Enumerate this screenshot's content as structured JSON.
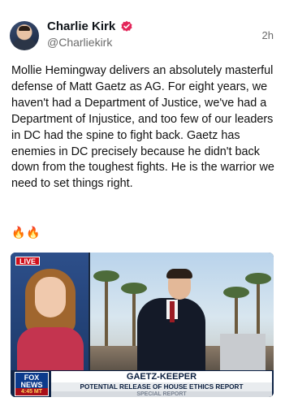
{
  "author": {
    "name": "Charlie Kirk",
    "handle": "@Charliekirk",
    "verified_icon": "verified-badge-icon",
    "avatar_icon": "profile-photo"
  },
  "post": {
    "time": "2h",
    "text": "Mollie Hemingway delivers an absolutely masterful defense of Matt Gaetz as AG. For eight years, we haven't had a Department of Justice, we've had a Department of Injustice, and too few of our leaders in DC had the spine to fight back. Gaetz has enemies in DC precisely because he didn't back down from the toughest fights. He is the warrior we need to set things right.",
    "emoji": "🔥🔥"
  },
  "media": {
    "live_label": "LIVE",
    "network_logo": "FOX NEWS",
    "network_time": "4:45 MT",
    "headline": "GAETZ-KEEPER",
    "subheadline": "POTENTIAL RELEASE OF HOUSE ETHICS REPORT",
    "ticker_ghost": "SPECIAL REPORT"
  },
  "colors": {
    "brand_red": "#d10f1b",
    "verified_red": "#e3265a",
    "banner_navy": "#0f2447"
  }
}
